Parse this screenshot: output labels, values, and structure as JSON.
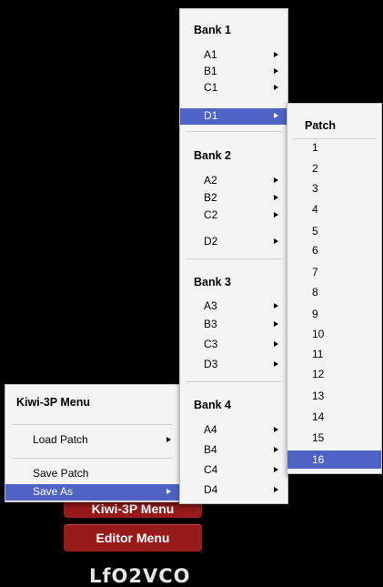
{
  "kiwi_menu": {
    "title": "Kiwi-3P Menu",
    "items": [
      {
        "label": "Load Patch"
      },
      {
        "label": "Save Patch"
      },
      {
        "label": "Save As"
      }
    ]
  },
  "background": {
    "hidden_button_label": "Kiwi-3P Menu",
    "editor_menu_label": "Editor Menu",
    "logo_text": "LfO2VCO"
  },
  "bank_menu": {
    "banks": [
      {
        "title": "Bank 1",
        "items": [
          "A1",
          "B1",
          "C1",
          "D1"
        ]
      },
      {
        "title": "Bank 2",
        "items": [
          "A2",
          "B2",
          "C2",
          "D2"
        ]
      },
      {
        "title": "Bank 3",
        "items": [
          "A3",
          "B3",
          "C3",
          "D3"
        ]
      },
      {
        "title": "Bank 4",
        "items": [
          "A4",
          "B4",
          "C4",
          "D4"
        ]
      }
    ],
    "selected": "D1"
  },
  "patch_menu": {
    "title": "Patch",
    "items": [
      "1",
      "2",
      "3",
      "4",
      "5",
      "6",
      "7",
      "8",
      "9",
      "10",
      "11",
      "12",
      "13",
      "14",
      "15",
      "16"
    ],
    "selected": "16"
  },
  "colors": {
    "selection": "#4f63c7",
    "menu_bg": "#f4f4f4",
    "button_red": "#991a1a"
  },
  "icons": [
    "submenu-arrow-icon"
  ]
}
